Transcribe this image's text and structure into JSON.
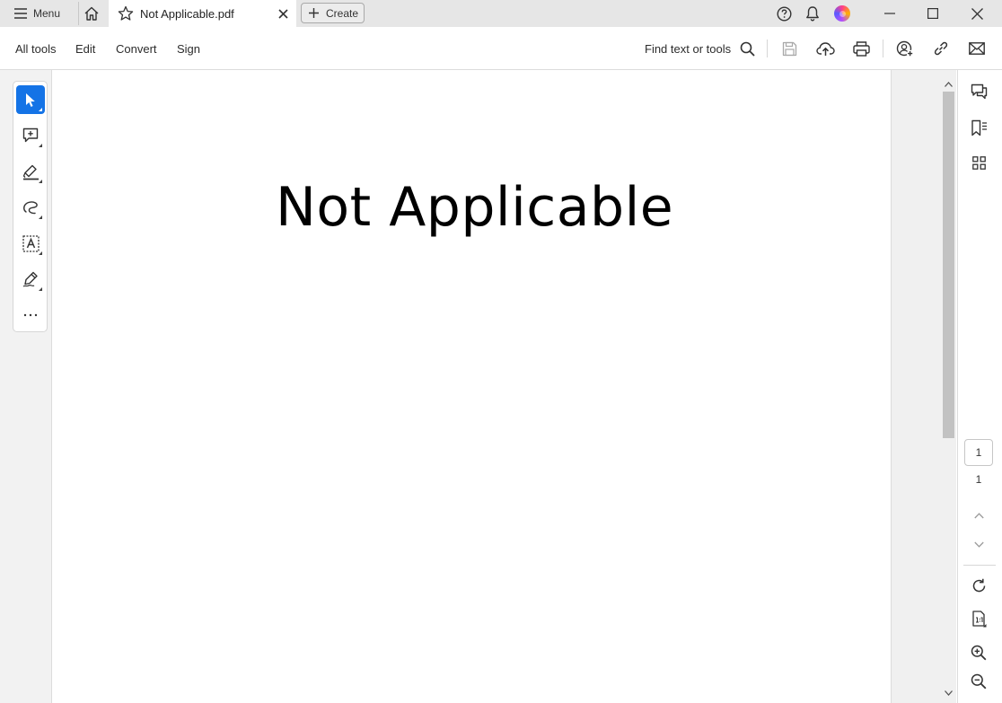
{
  "titlebar": {
    "menu_label": "Menu",
    "tab_title": "Not Applicable.pdf",
    "create_label": "Create"
  },
  "toolbar": {
    "menu_items": [
      "All tools",
      "Edit",
      "Convert",
      "Sign"
    ],
    "find_label": "Find text or tools"
  },
  "document": {
    "text": "Not Applicable"
  },
  "page_nav": {
    "current_page": "1",
    "total_pages": "1"
  },
  "colors": {
    "accent": "#1473e6",
    "titlebar_bg": "#e6e6e6"
  },
  "icons": {
    "left_tools": [
      "select-cursor-icon",
      "add-comment-icon",
      "highlight-icon",
      "draw-freeform-icon",
      "add-text-icon",
      "fill-sign-icon",
      "more-tools-icon"
    ],
    "right_tools": [
      "comments-icon",
      "bookmarks-icon",
      "thumbnails-icon",
      "rotate-icon",
      "fit-page-icon",
      "zoom-in-icon",
      "zoom-out-icon"
    ]
  }
}
